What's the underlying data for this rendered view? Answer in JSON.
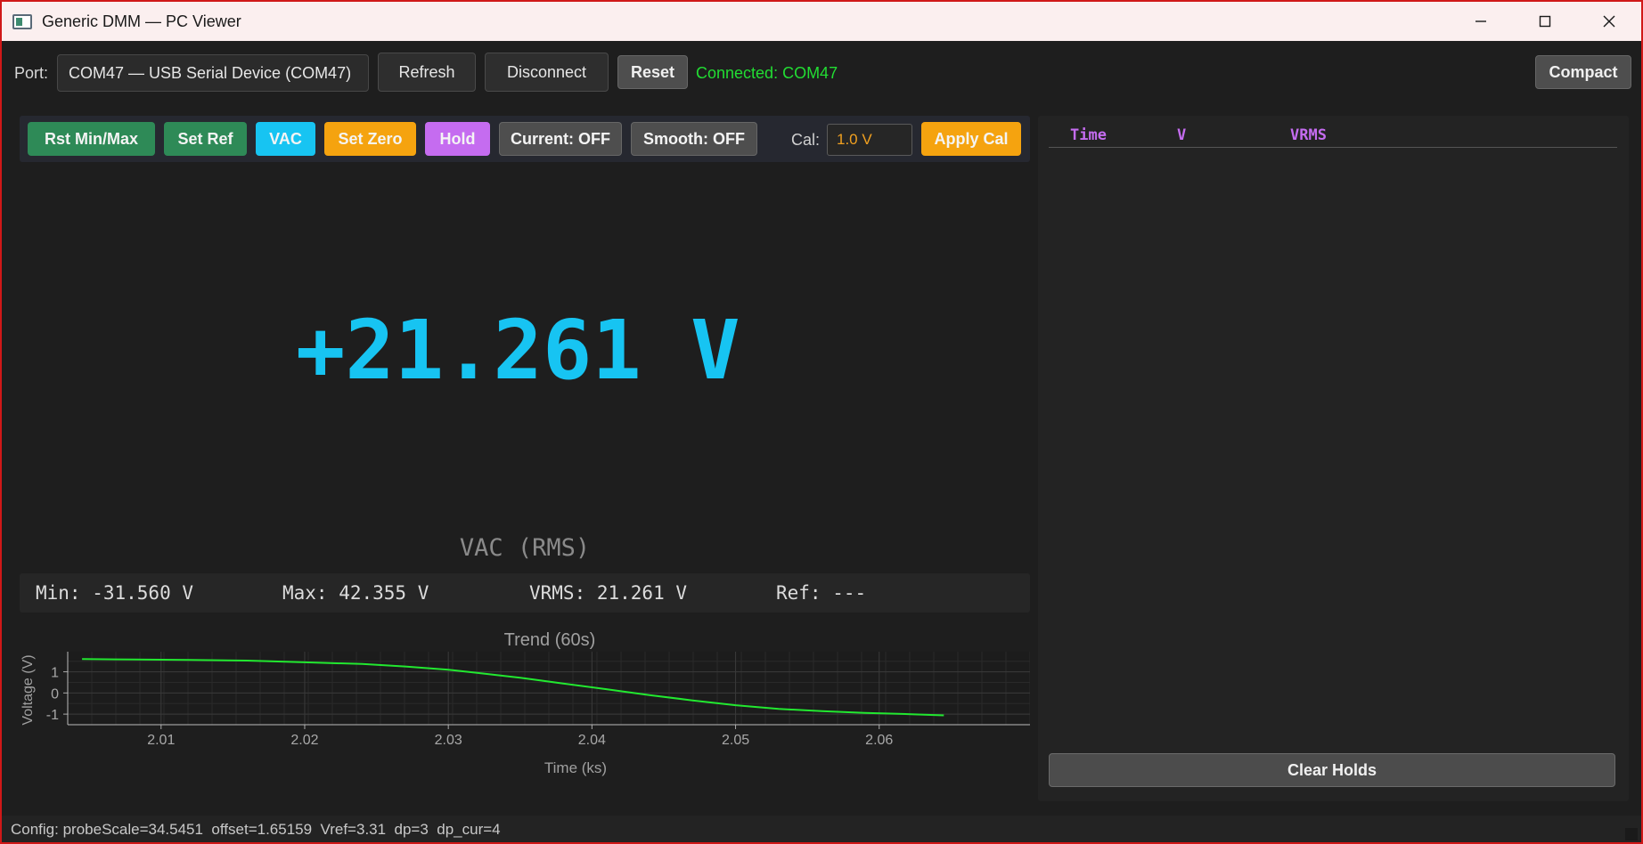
{
  "window": {
    "title": "Generic DMM — PC Viewer",
    "controls": {
      "minimize": "minimize-icon",
      "maximize": "maximize-icon",
      "close": "close-icon"
    }
  },
  "connection": {
    "port_label": "Port:",
    "port_value": "COM47 — USB Serial Device (COM47)",
    "refresh_label": "Refresh",
    "disconnect_label": "Disconnect",
    "reset_label": "Reset",
    "status": "Connected: COM47",
    "compact_label": "Compact"
  },
  "toolbar": {
    "rst_minmax": "Rst Min/Max",
    "set_ref": "Set Ref",
    "mode": "VAC",
    "set_zero": "Set Zero",
    "hold": "Hold",
    "current": "Current: OFF",
    "smooth": "Smooth: OFF",
    "cal_label": "Cal:",
    "cal_value": "1.0 V",
    "apply_cal": "Apply Cal"
  },
  "colors": {
    "green_btn": "#2e8a57",
    "cyan_btn": "#17c4f2",
    "orange_btn": "#f5a30f",
    "purple_btn": "#c56cf0",
    "grey_btn": "#4e4e4e",
    "reading": "#17c4f2",
    "status_ok": "#22dd33",
    "trace": "#22e830"
  },
  "display": {
    "reading": "+21.261 V",
    "mode_label": "VAC (RMS)"
  },
  "stats": {
    "min": "Min: -31.560 V",
    "max": "Max: 42.355 V",
    "vrms": "VRMS: 21.261 V",
    "ref": "Ref: ---"
  },
  "holds": {
    "columns": [
      "Time",
      "V",
      "VRMS"
    ],
    "rows": [],
    "clear_label": "Clear Holds"
  },
  "statusbar": {
    "config": "Config: probeScale=34.5451  offset=1.65159  Vref=3.31  dp=3  dp_cur=4"
  },
  "chart_data": {
    "type": "line",
    "title": "Trend (60s)",
    "xlabel": "Time (ks)",
    "ylabel": "Voltage (V)",
    "xlim": [
      2.0035,
      2.0705
    ],
    "ylim": [
      -1.5,
      1.95
    ],
    "xticks": [
      "2.01",
      "2.02",
      "2.03",
      "2.04",
      "2.05",
      "2.06"
    ],
    "yticks": [
      "1",
      "0",
      "-1"
    ],
    "grid": true,
    "series": [
      {
        "x": [
          2.0045,
          2.008,
          2.012,
          2.016,
          2.02,
          2.024,
          2.027,
          2.03,
          2.032,
          2.035,
          2.038,
          2.041,
          2.044,
          2.047,
          2.05,
          2.053,
          2.056,
          2.059,
          2.062,
          2.0645
        ],
        "y": [
          1.6,
          1.58,
          1.56,
          1.53,
          1.45,
          1.37,
          1.25,
          1.1,
          0.95,
          0.72,
          0.45,
          0.18,
          -0.1,
          -0.35,
          -0.58,
          -0.75,
          -0.86,
          -0.94,
          -1.0,
          -1.06
        ]
      }
    ]
  }
}
